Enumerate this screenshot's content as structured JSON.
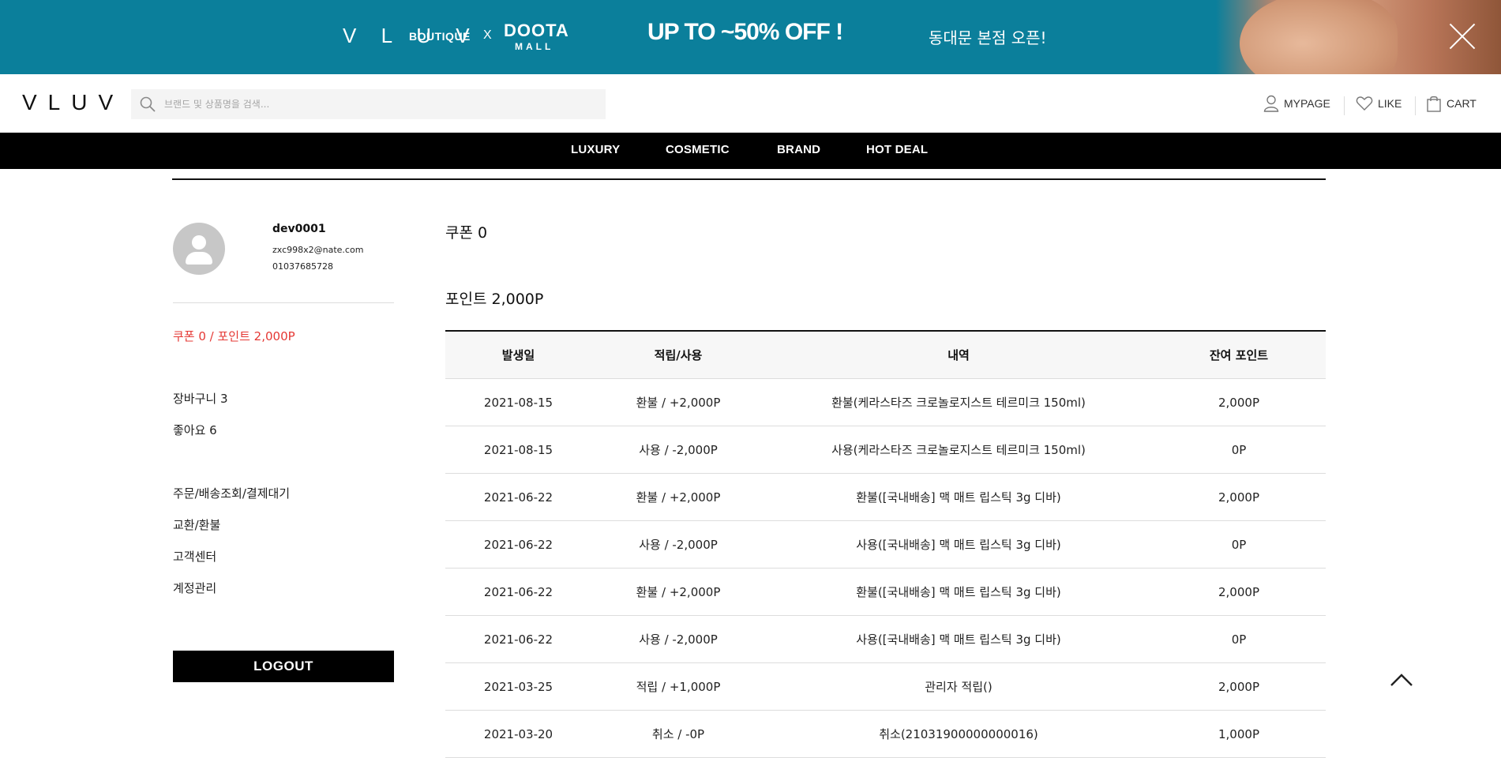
{
  "banner": {
    "brand": "V L U V",
    "boutique": "BOUTIQUE",
    "x": "X",
    "partner_top": "DOOTA",
    "partner_bottom": "MALL",
    "sale": "UP TO ~50% OFF !",
    "open": "동대문 본점 오픈!",
    "close_icon": "close-icon",
    "background": "#0b7f9b"
  },
  "header": {
    "logo": "VLUV",
    "search_placeholder": "브랜드 및 상품명을 검색...",
    "util": {
      "mypage": "MYPAGE",
      "like": "LIKE",
      "cart": "CART"
    }
  },
  "gnb": {
    "items": [
      "LUXURY",
      "COSMETIC",
      "BRAND",
      "HOT DEAL"
    ]
  },
  "profile": {
    "id": "dev0001",
    "email": "zxc998x2@nate.com",
    "phone": "01037685728"
  },
  "sidebar": {
    "summary": "쿠폰 0 / 포인트 2,000P",
    "cart": "장바구니 3",
    "like": "좋아요 6",
    "menu": [
      "주문/배송조회/결제대기",
      "교환/환불",
      "고객센터",
      "계정관리"
    ],
    "logout": "LOGOUT",
    "accent_color": "#e53935"
  },
  "main": {
    "coupon_title": "쿠폰 0",
    "point_title": "포인트 2,000P",
    "table": {
      "headers": [
        "발생일",
        "적립/사용",
        "내역",
        "잔여 포인트"
      ],
      "rows": [
        [
          "2021-08-15",
          "환불 / +2,000P",
          "환불(케라스타즈 크로놀로지스트 테르미크 150ml)",
          "2,000P"
        ],
        [
          "2021-08-15",
          "사용 / -2,000P",
          "사용(케라스타즈 크로놀로지스트 테르미크 150ml)",
          "0P"
        ],
        [
          "2021-06-22",
          "환불 / +2,000P",
          "환불([국내배송] 맥 매트 립스틱 3g 디바)",
          "2,000P"
        ],
        [
          "2021-06-22",
          "사용 / -2,000P",
          "사용([국내배송] 맥 매트 립스틱 3g 디바)",
          "0P"
        ],
        [
          "2021-06-22",
          "환불 / +2,000P",
          "환불([국내배송] 맥 매트 립스틱 3g 디바)",
          "2,000P"
        ],
        [
          "2021-06-22",
          "사용 / -2,000P",
          "사용([국내배송] 맥 매트 립스틱 3g 디바)",
          "0P"
        ],
        [
          "2021-03-25",
          "적립 / +1,000P",
          "관리자 적립()",
          "2,000P"
        ],
        [
          "2021-03-20",
          "취소 / -0P",
          "취소(21031900000000016)",
          "1,000P"
        ]
      ]
    }
  }
}
